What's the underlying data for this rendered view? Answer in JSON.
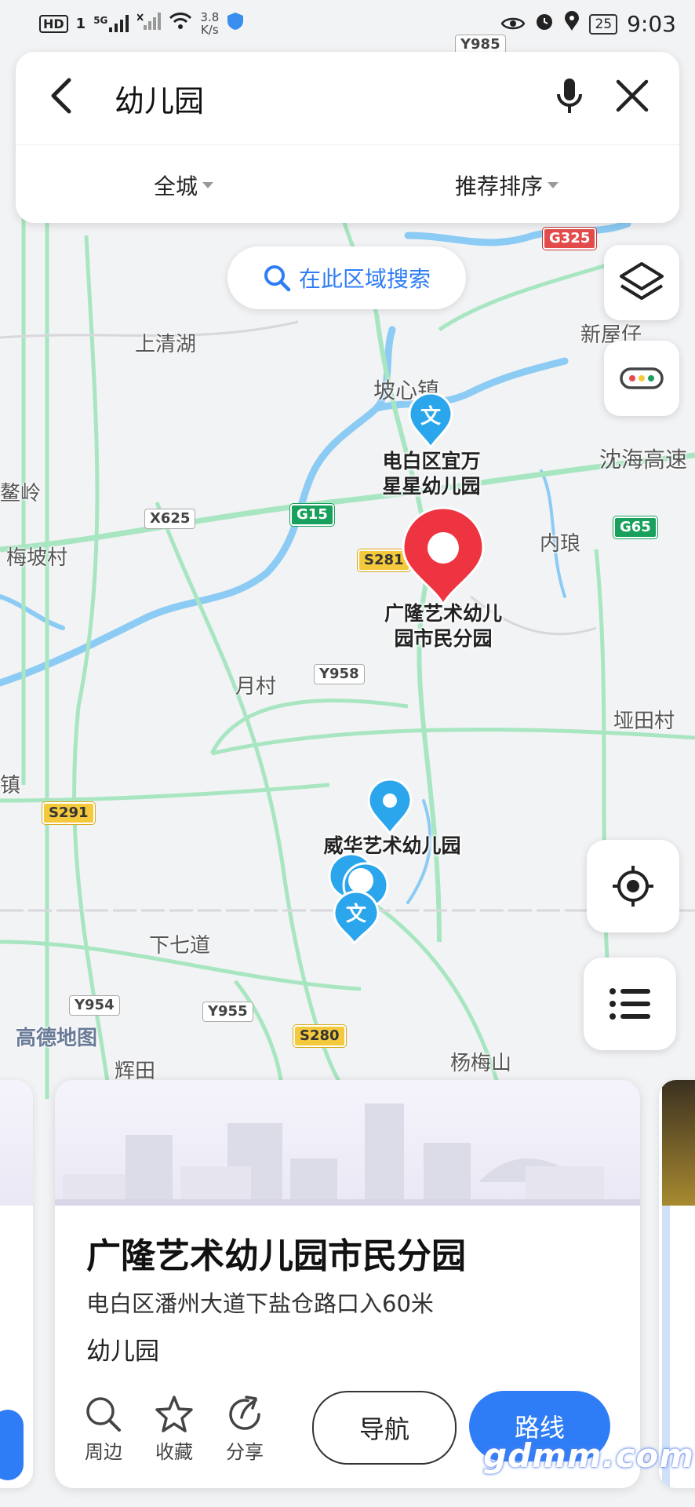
{
  "status_bar": {
    "hd": "HD",
    "sim": "1",
    "network": "5G",
    "speed_value": "3.8",
    "speed_unit": "K/s",
    "battery": "25",
    "time": "9:03"
  },
  "search": {
    "query": "幼儿园",
    "filter_city": "全城",
    "filter_sort": "推荐排序"
  },
  "area_search_label": "在此区域搜索",
  "map": {
    "labels": [
      {
        "text": "上清湖"
      },
      {
        "text": "坡心镇"
      },
      {
        "text": "新屋仔"
      },
      {
        "text": "沈海高速"
      },
      {
        "text": "鳌岭"
      },
      {
        "text": "梅坡村"
      },
      {
        "text": "内琅"
      },
      {
        "text": "月村"
      },
      {
        "text": "垭田村"
      },
      {
        "text": "镇"
      },
      {
        "text": "下七道"
      },
      {
        "text": "辉田"
      },
      {
        "text": "杨梅山"
      }
    ],
    "shields": [
      {
        "text": "Y985",
        "style": "white"
      },
      {
        "text": "G325",
        "style": "red"
      },
      {
        "text": "X625",
        "style": "white"
      },
      {
        "text": "G15",
        "style": "green"
      },
      {
        "text": "S281",
        "style": "yellow"
      },
      {
        "text": "G65",
        "style": "green"
      },
      {
        "text": "Y958",
        "style": "white"
      },
      {
        "text": "S291",
        "style": "yellow"
      },
      {
        "text": "Y954",
        "style": "white"
      },
      {
        "text": "Y955",
        "style": "white"
      },
      {
        "text": "S280",
        "style": "yellow"
      }
    ],
    "logo": "高德地图"
  },
  "markers": {
    "poi1_name": "电白区宜万\n星星幼儿园",
    "poi1_glyph": "文",
    "selected_name": "广隆艺术幼儿\n园市民分园",
    "poi2_name": "威华艺术幼儿园",
    "cluster_glyph": "文"
  },
  "result_card": {
    "title": "广隆艺术幼儿园市民分园",
    "address": "电白区潘州大道下盐仓路口入60米",
    "category": "幼儿园",
    "actions": {
      "nearby": "周边",
      "favorite": "收藏",
      "share": "分享"
    },
    "navigate": "导航",
    "route": "路线"
  },
  "watermark": "gdmm.com",
  "colors": {
    "accent": "#2f7df6",
    "selected_marker": "#ee3440",
    "poi_marker": "#2ba6ec",
    "road": "#9ee3b8",
    "water": "#7cc4f2"
  }
}
